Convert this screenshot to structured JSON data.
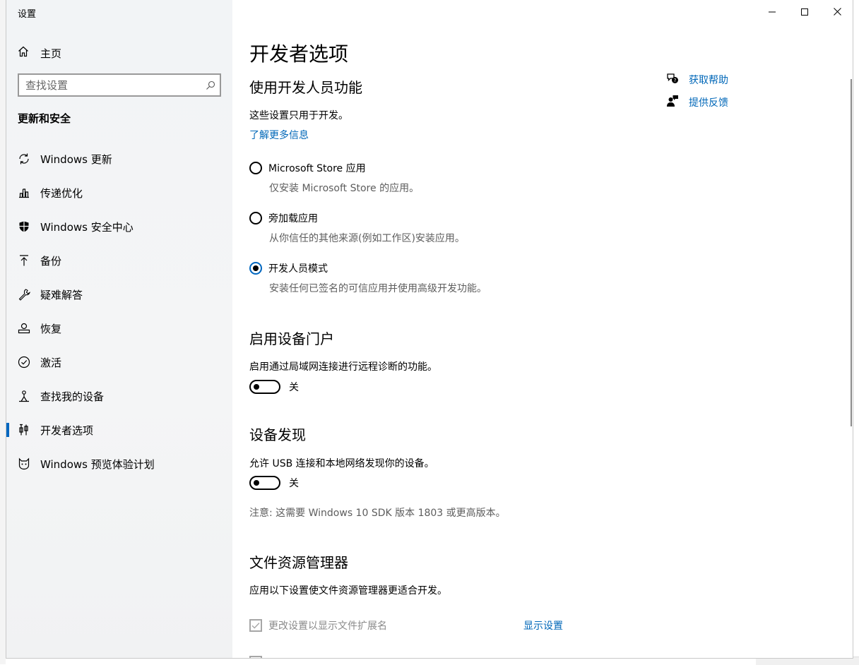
{
  "window": {
    "title": "设置",
    "controls": {
      "minimize": "minimize-icon",
      "maximize": "maximize-icon",
      "close": "close-icon"
    }
  },
  "sidebar": {
    "home_label": "主页",
    "search_placeholder": "查找设置",
    "section_title": "更新和安全",
    "items": [
      {
        "label": "Windows 更新",
        "icon": "sync-icon"
      },
      {
        "label": "传递优化",
        "icon": "delivery-optimization-icon"
      },
      {
        "label": "Windows 安全中心",
        "icon": "shield-icon"
      },
      {
        "label": "备份",
        "icon": "backup-arrow-icon"
      },
      {
        "label": "疑难解答",
        "icon": "wrench-icon"
      },
      {
        "label": "恢复",
        "icon": "recovery-icon"
      },
      {
        "label": "激活",
        "icon": "check-circle-icon"
      },
      {
        "label": "查找我的设备",
        "icon": "find-device-icon"
      },
      {
        "label": "开发者选项",
        "icon": "developer-tools-icon",
        "active": true
      },
      {
        "label": "Windows 预览体验计划",
        "icon": "insider-cat-icon"
      }
    ]
  },
  "main": {
    "page_title": "开发者选项",
    "dev_section": {
      "heading": "使用开发人员功能",
      "description": "这些设置只用于开发。",
      "learn_more": "了解更多信息",
      "options": [
        {
          "label": "Microsoft Store 应用",
          "sub": "仅安装 Microsoft Store 的应用。",
          "selected": false
        },
        {
          "label": "旁加载应用",
          "sub": "从你信任的其他来源(例如工作区)安装应用。",
          "selected": false
        },
        {
          "label": "开发人员模式",
          "sub": "安装任何已签名的可信应用并使用高级开发功能。",
          "selected": true
        }
      ]
    },
    "portal_section": {
      "heading": "启用设备门户",
      "description": "启用通过局域网连接进行远程诊断的功能。",
      "toggle_label": "关",
      "toggle_on": false
    },
    "discovery_section": {
      "heading": "设备发现",
      "description": "允许 USB 连接和本地网络发现你的设备。",
      "toggle_label": "关",
      "toggle_on": false,
      "note": "注意: 这需要 Windows 10 SDK 版本 1803 或更高版本。"
    },
    "explorer_section": {
      "heading": "文件资源管理器",
      "description": "应用以下设置使文件资源管理器更适合开发。",
      "checkbox_label": "更改设置以显示文件扩展名",
      "checkbox_checked": true,
      "show_settings": "显示设置"
    },
    "help_links": {
      "get_help": "获取帮助",
      "feedback": "提供反馈"
    }
  },
  "colors": {
    "accent": "#0067c0",
    "link": "#0067b8",
    "sidebar_bg": "#f2f4f6",
    "muted_text": "#5d5d5d"
  }
}
